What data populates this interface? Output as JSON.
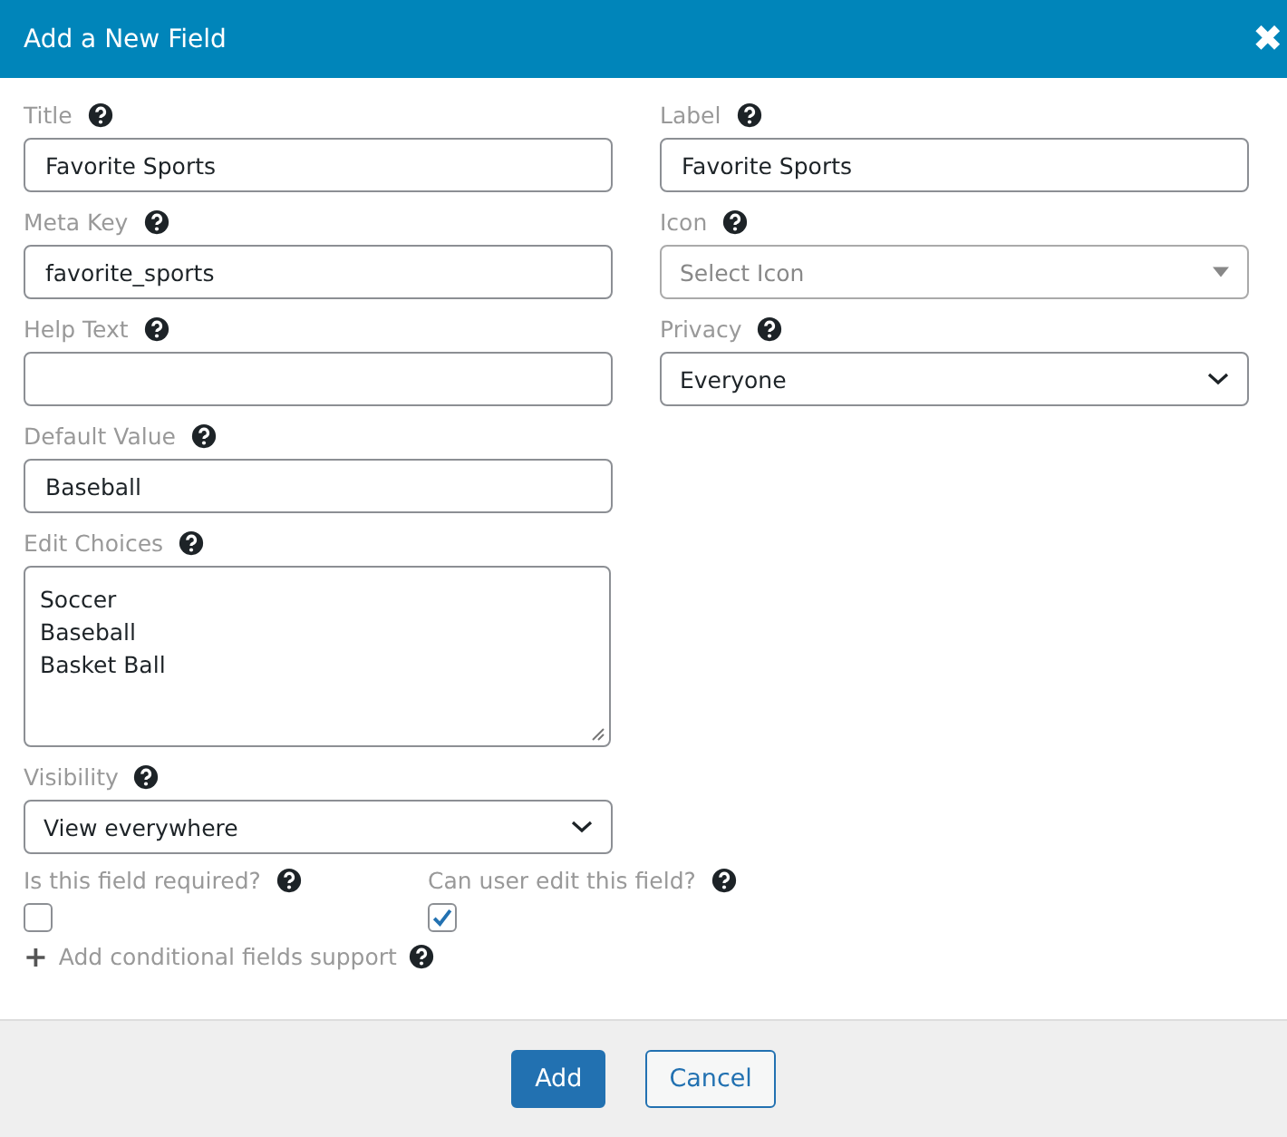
{
  "dialog": {
    "title": "Add a New Field",
    "close": "✖"
  },
  "left_fields": [
    {
      "kind": "text",
      "label": "Title",
      "value": "Favorite Sports"
    },
    {
      "kind": "text",
      "label": "Meta Key",
      "value": "favorite_sports"
    },
    {
      "kind": "text",
      "label": "Help Text"
    },
    {
      "kind": "text",
      "label": "Default Value",
      "value": "Baseball"
    },
    {
      "kind": "textarea",
      "label": "Edit Choices",
      "lines": [
        "Soccer",
        "Baseball",
        "Basket Ball"
      ]
    },
    {
      "kind": "select",
      "label": "Visibility",
      "value": "View everywhere"
    }
  ],
  "right_fields": [
    {
      "kind": "text",
      "label": "Label",
      "value": "Favorite Sports"
    },
    {
      "kind": "combo",
      "label": "Icon",
      "placeholder": "Select Icon"
    },
    {
      "kind": "select",
      "label": "Privacy",
      "value": "Everyone"
    }
  ],
  "checkboxes": [
    {
      "label": "Is this field required?",
      "checked": false
    },
    {
      "label": "Can user edit this field?",
      "checked": true
    }
  ],
  "conditional_link": {
    "icon": "+",
    "label": "Add conditional fields support"
  },
  "buttons": [
    {
      "label": "Add",
      "kind": "primary"
    },
    {
      "label": "Cancel",
      "kind": "secondary"
    }
  ]
}
